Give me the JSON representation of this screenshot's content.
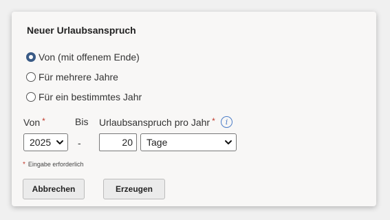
{
  "dialog": {
    "title": "Neuer Urlaubsanspruch"
  },
  "options": [
    {
      "label": "Von (mit offenem Ende)",
      "checked": true
    },
    {
      "label": "Für mehrere Jahre",
      "checked": false
    },
    {
      "label": "Für ein bestimmtes Jahr",
      "checked": false
    }
  ],
  "fields": {
    "von_label": "Von",
    "bis_label": "Bis",
    "anspruch_label": "Urlaubsanspruch pro Jahr",
    "required_marker": "*",
    "year_value": "2025",
    "separator": "-",
    "amount_value": "20",
    "unit_value": "Tage",
    "info_glyph": "i"
  },
  "hint": {
    "marker": "*",
    "text": "Eingabe erforderlich"
  },
  "buttons": {
    "cancel": "Abbrechen",
    "create": "Erzeugen"
  },
  "colors": {
    "accent": "#3b5b86",
    "required": "#c0392b",
    "info": "#4a7cc7"
  },
  "icons": {
    "info": "info-icon",
    "dropdown": "chevron-down-icon"
  }
}
